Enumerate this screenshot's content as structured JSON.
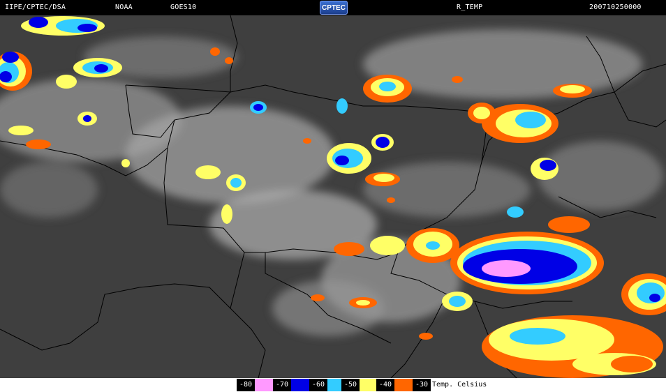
{
  "header": {
    "source": "IIPE/CPTEC/DSA",
    "agency": "NOAA",
    "satellite": "GOES10",
    "logo_text": "CPTEC",
    "product": "R_TEMP",
    "timestamp": "200710250000"
  },
  "legend": {
    "title": "Temp. Celsius",
    "entries": [
      {
        "value": "-80",
        "color": "#ff99ff"
      },
      {
        "value": "-70",
        "color": "#0000e6"
      },
      {
        "value": "-60",
        "color": "#33ccff"
      },
      {
        "value": "-50",
        "color": "#ffff66"
      },
      {
        "value": "-40",
        "color": "#ff6600"
      },
      {
        "value": "-30",
        "color": "#ffffff"
      }
    ]
  },
  "colors": {
    "background": "#3f3f3f",
    "cloud": "#cfcfcf",
    "border_line": "#000000"
  }
}
